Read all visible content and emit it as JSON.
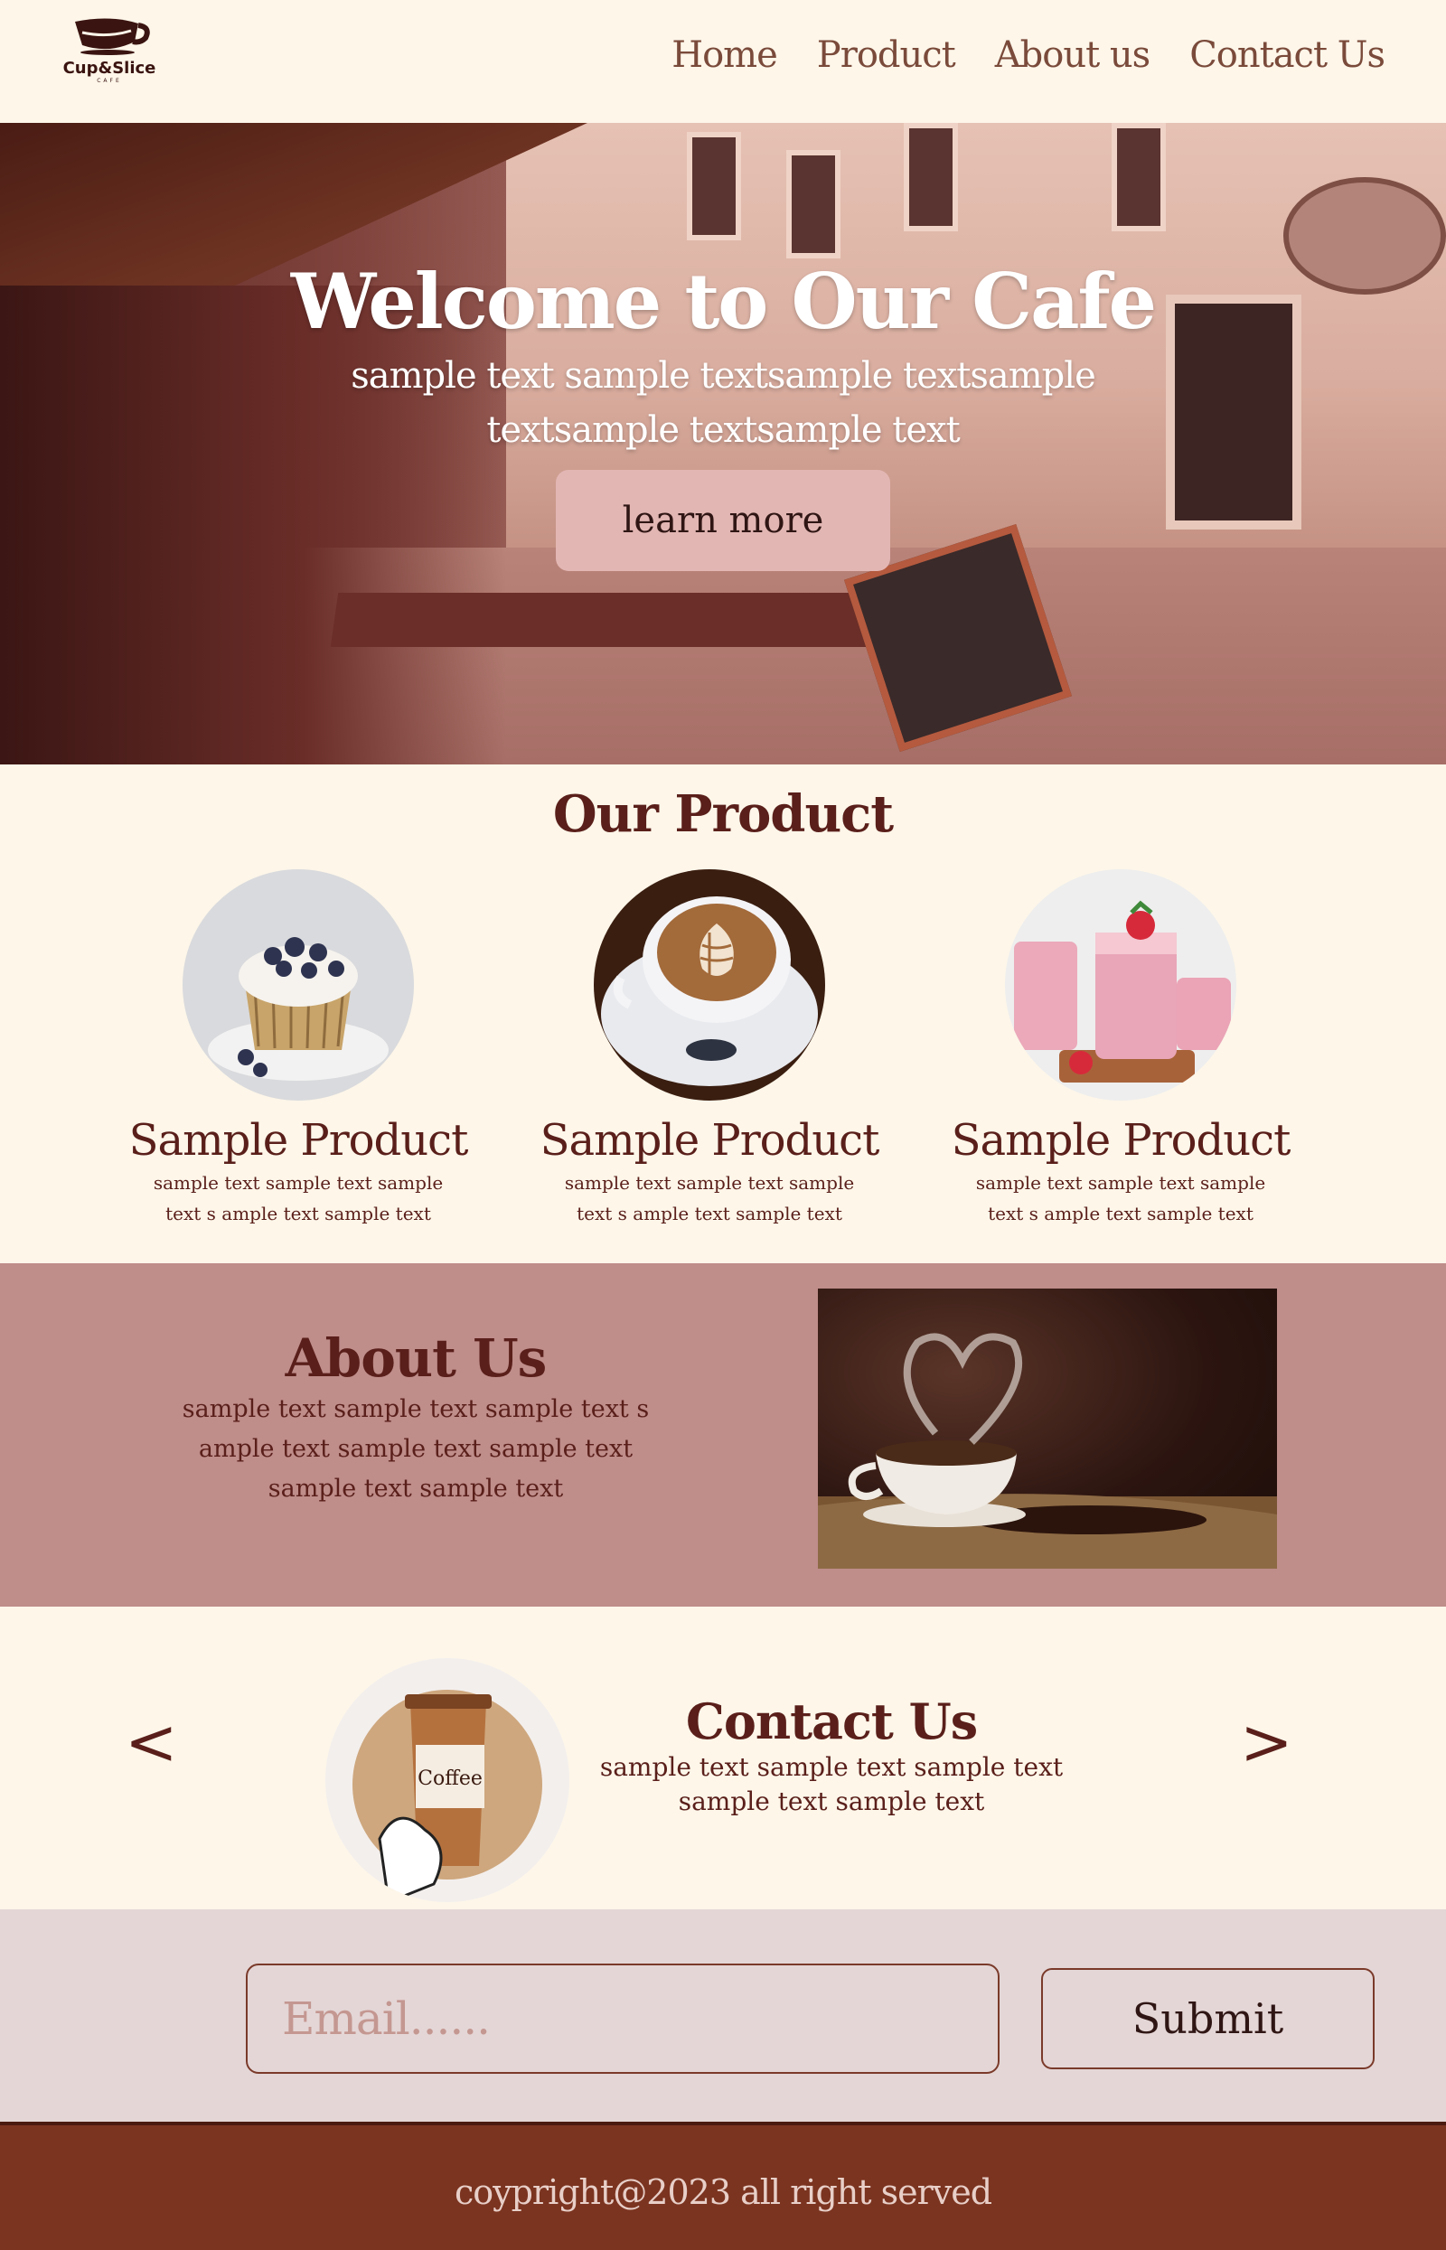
{
  "brand": {
    "name": "Cup&Slice",
    "sub": "CAFE"
  },
  "nav": {
    "links": [
      "Home",
      "Product",
      "About us",
      "Contact Us"
    ]
  },
  "hero": {
    "title": "Welcome to Our Cafe",
    "subtitle": "sample text sample textsample textsample textsample textsample text",
    "button_label": "learn more"
  },
  "products": {
    "title": "Our Product",
    "items": [
      {
        "name": "Sample Product",
        "desc": "sample text sample text sample text s ample text sample text",
        "icon": "muffin-image"
      },
      {
        "name": "Sample Product",
        "desc": "sample text sample text sample text s ample text sample text",
        "icon": "latte-image"
      },
      {
        "name": "Sample Product",
        "desc": "sample text sample text sample text s ample text sample text",
        "icon": "smoothie-image"
      }
    ]
  },
  "about": {
    "title": "About Us",
    "desc": "sample text sample text sample text s ample text sample text sample text sample text sample text"
  },
  "contact": {
    "title": "Contact Us",
    "desc": "sample text sample text sample text sample text sample text",
    "prev": "<",
    "next": ">",
    "cup_label": "Coffee"
  },
  "newsletter": {
    "placeholder": "Email......",
    "submit_label": "Submit"
  },
  "footer": {
    "text": "coypright@2023 all right served"
  },
  "colors": {
    "background": "#fdf6e9",
    "accent": "#5a1f1a",
    "about_bg": "#bf8d8a",
    "newsletter_bg": "#e4d6d6",
    "footer_bg": "#7b3420",
    "button_bg": "#e2b6b3"
  }
}
